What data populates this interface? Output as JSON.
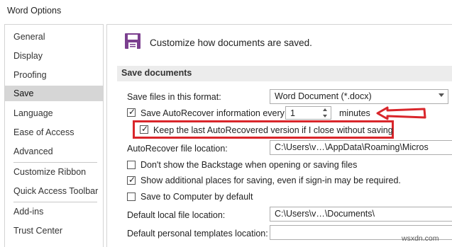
{
  "window": {
    "title": "Word Options"
  },
  "sidebar": {
    "items": [
      {
        "label": "General"
      },
      {
        "label": "Display"
      },
      {
        "label": "Proofing"
      },
      {
        "label": "Save",
        "selected": true
      },
      {
        "label": "Language"
      },
      {
        "label": "Ease of Access"
      },
      {
        "label": "Advanced"
      },
      {
        "label": "Customize Ribbon"
      },
      {
        "label": "Quick Access Toolbar"
      },
      {
        "label": "Add-ins"
      },
      {
        "label": "Trust Center"
      }
    ]
  },
  "main": {
    "heading": "Customize how documents are saved.",
    "section_title": "Save documents",
    "format_label": "Save files in this format:",
    "format_value": "Word Document (*.docx)",
    "autorecover_label": "Save AutoRecover information every",
    "autorecover_minutes": "1",
    "minutes_label": "minutes",
    "keep_last_label": "Keep the last AutoRecovered version if I close without saving",
    "ar_location_label": "AutoRecover file location:",
    "ar_location_value": "C:\\Users\\v…\\AppData\\Roaming\\Micros",
    "backstage_label": "Don't show the Backstage when opening or saving files",
    "additional_places_label": "Show additional places for saving, even if sign-in may be required.",
    "save_computer_label": "Save to Computer by default",
    "default_local_label": "Default local file location:",
    "default_local_value": "C:\\Users\\v…\\Documents\\",
    "personal_templates_label": "Default personal templates location:",
    "personal_templates_value": ""
  },
  "checkbox_states": {
    "autorecover": true,
    "keep_last": true,
    "backstage": false,
    "additional_places": true,
    "save_computer": false
  },
  "watermark": "wsxdn.com",
  "colors": {
    "highlight": "#d9262b",
    "selected_bg": "#d6d6d6",
    "section_bg": "#ececec",
    "icon_purple": "#7b3f8f"
  },
  "icons": {
    "save": "floppy-disk-icon"
  }
}
